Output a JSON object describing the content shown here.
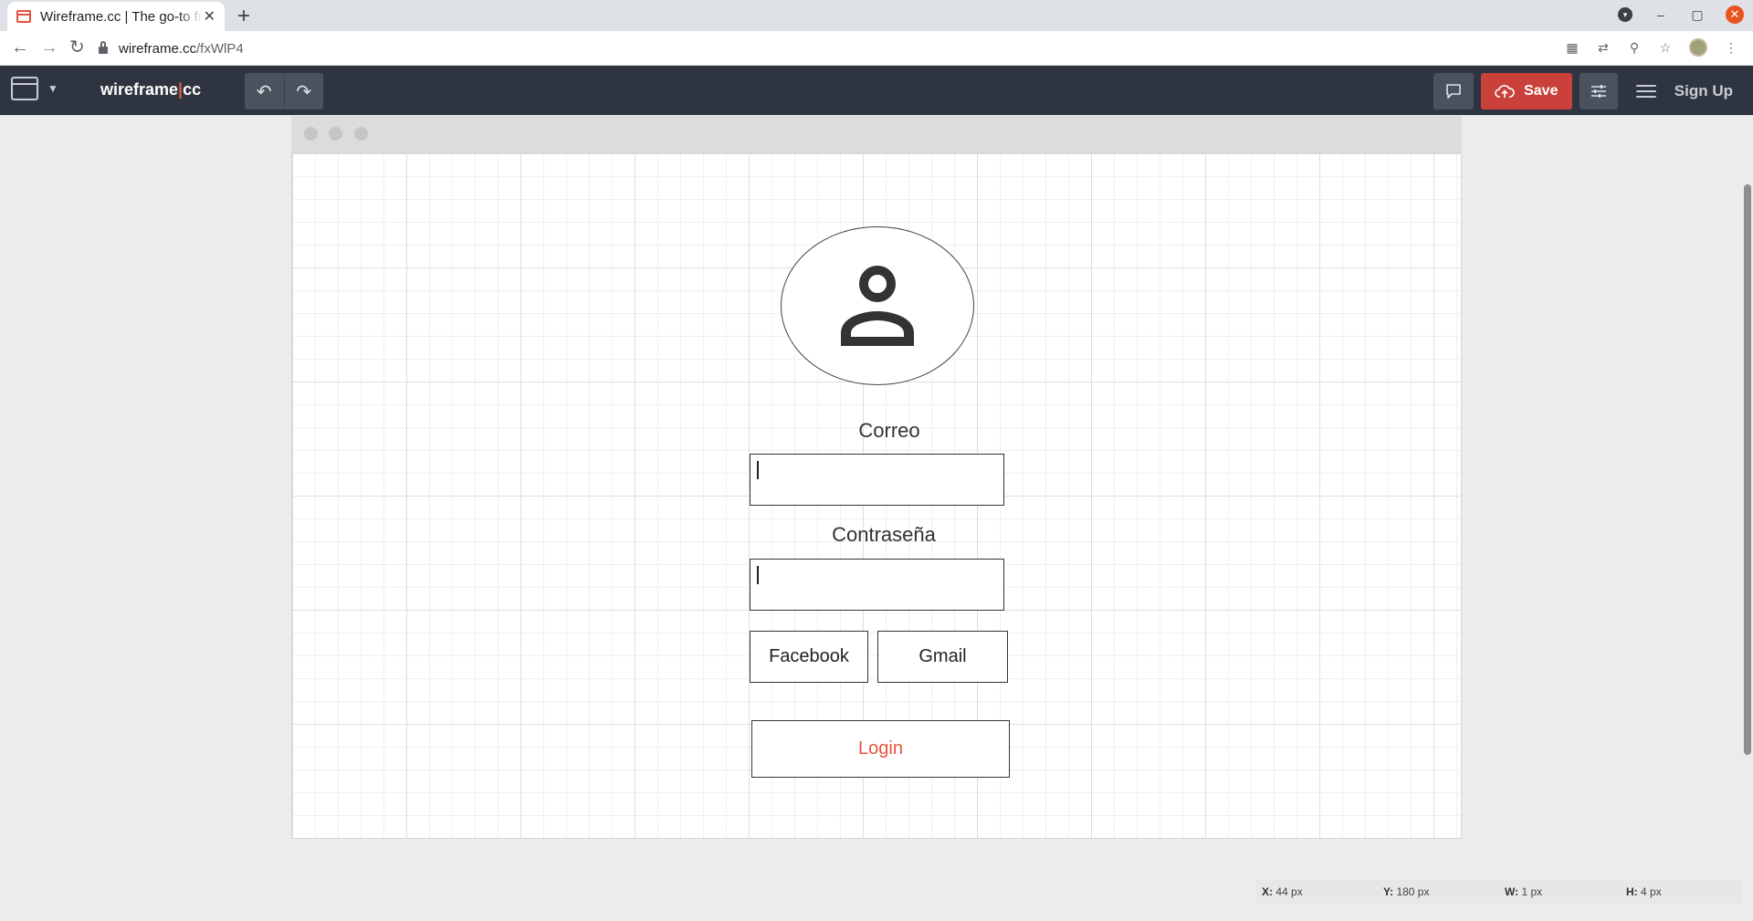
{
  "browser": {
    "tab_title": "Wireframe.cc | The go-to free online wireframe tool",
    "tab_close": "✕",
    "new_tab": "+",
    "url_host": "wireframe.cc",
    "url_path": "/fxWlP4",
    "window_controls": {
      "minimize": "–",
      "restore": "▢",
      "close": "✕"
    }
  },
  "toolbar": {
    "logo_left": "wireframe",
    "logo_bar": "|",
    "logo_right": "cc",
    "undo_icon": "↶",
    "redo_icon": "↷",
    "save_label": "Save",
    "signup_label": "Sign Up",
    "accent_color": "#c9413a"
  },
  "wireframe": {
    "email_label": "Correo",
    "password_label": "Contraseña",
    "facebook_label": "Facebook",
    "gmail_label": "Gmail",
    "login_label": "Login",
    "login_color": "#e4533f"
  },
  "status": {
    "x_label": "X:",
    "x_value": "44 px",
    "y_label": "Y:",
    "y_value": "180 px",
    "w_label": "W:",
    "w_value": "1 px",
    "h_label": "H:",
    "h_value": "4 px"
  }
}
